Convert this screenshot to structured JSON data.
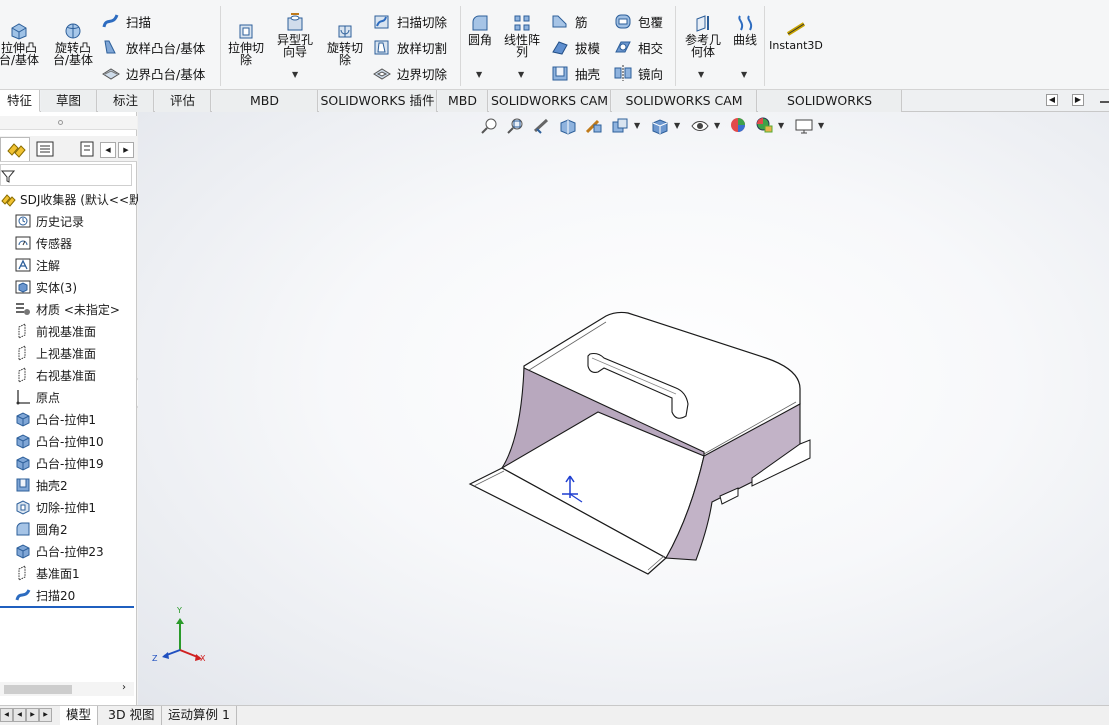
{
  "ribbon": {
    "extrude_boss": "拉伸凸\n台/基体",
    "revolve_boss": "旋转凸\n台/基体",
    "sweep": "扫描",
    "loft_boss": "放样凸台/基体",
    "boundary_boss": "边界凸台/基体",
    "extrude_cut": "拉伸切\n除",
    "hole_wizard": "异型孔\n向导",
    "revolve_cut": "旋转切\n除",
    "swept_cut": "扫描切除",
    "lofted_cut": "放样切割",
    "boundary_cut": "边界切除",
    "fillet": "圆角",
    "linear_pattern": "线性阵\n列",
    "rib": "筋",
    "draft": "拔模",
    "shell": "抽壳",
    "wrap": "包覆",
    "intersect": "相交",
    "mirror": "镜向",
    "ref_geometry": "参考几\n何体",
    "curves": "曲线",
    "instant3d": "Instant3D"
  },
  "tabs": [
    {
      "label": "特征",
      "active": true
    },
    {
      "label": "草图",
      "active": false
    },
    {
      "label": "标注",
      "active": false
    },
    {
      "label": "评估",
      "active": false
    },
    {
      "label": "MBD Dimensions",
      "active": false
    },
    {
      "label": "SOLIDWORKS 插件",
      "active": false
    },
    {
      "label": "MBD",
      "active": false
    },
    {
      "label": "SOLIDWORKS CAM",
      "active": false
    },
    {
      "label": "SOLIDWORKS CAM TBM",
      "active": false
    },
    {
      "label": "SOLIDWORKS Inspection",
      "active": false
    }
  ],
  "tree": {
    "root": "SDJ收集器 (默认<<默",
    "items": [
      {
        "label": "历史记录",
        "icon": "history-icon"
      },
      {
        "label": "传感器",
        "icon": "sensor-icon"
      },
      {
        "label": "注解",
        "icon": "annotation-icon"
      },
      {
        "label": "实体(3)",
        "icon": "solid-bodies-icon"
      },
      {
        "label": "材质 <未指定>",
        "icon": "material-icon"
      },
      {
        "label": "前视基准面",
        "icon": "plane-icon"
      },
      {
        "label": "上视基准面",
        "icon": "plane-icon"
      },
      {
        "label": "右视基准面",
        "icon": "plane-icon"
      },
      {
        "label": "原点",
        "icon": "origin-icon"
      },
      {
        "label": "凸台-拉伸1",
        "icon": "extrude-feature-icon"
      },
      {
        "label": "凸台-拉伸10",
        "icon": "extrude-feature-icon"
      },
      {
        "label": "凸台-拉伸19",
        "icon": "extrude-feature-icon"
      },
      {
        "label": "抽壳2",
        "icon": "shell-feature-icon"
      },
      {
        "label": "切除-拉伸1",
        "icon": "cut-feature-icon"
      },
      {
        "label": "圆角2",
        "icon": "fillet-feature-icon"
      },
      {
        "label": "凸台-拉伸23",
        "icon": "extrude-feature-icon"
      },
      {
        "label": "基准面1",
        "icon": "plane-icon"
      },
      {
        "label": "扫描20",
        "icon": "sweep-feature-icon"
      }
    ]
  },
  "triad": {
    "x": "X",
    "y": "Y",
    "z": "Z"
  },
  "bottom_tabs": [
    {
      "label": "模型",
      "active": true
    },
    {
      "label": "3D 视图",
      "active": false
    },
    {
      "label": "运动算例 1",
      "active": false
    }
  ],
  "colors": {
    "accent_blue": "#1f5fbf",
    "part_inner": "#b7a6bc",
    "part_face": "#ffffff",
    "ribbon_bg": "#f5f6f7"
  }
}
